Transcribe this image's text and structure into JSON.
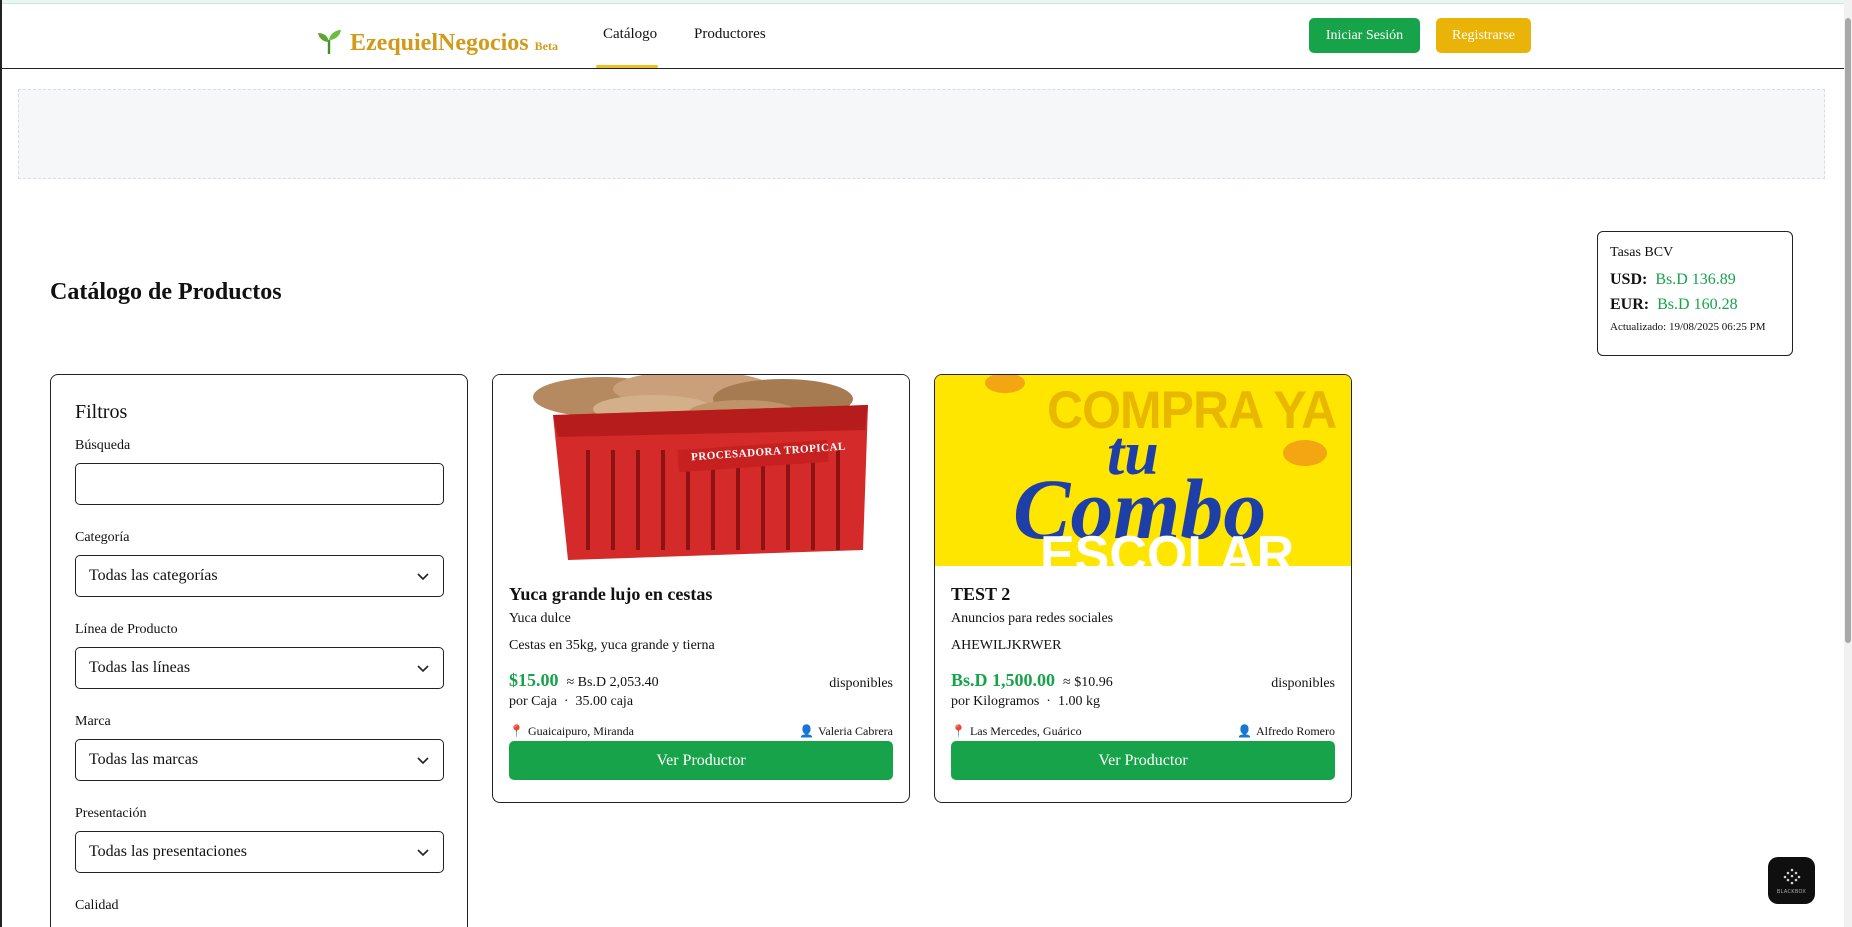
{
  "navbar": {
    "brand_name": "EzequielNegocios",
    "brand_badge": "Beta",
    "links": [
      "Catálogo",
      "Productores"
    ],
    "login_label": "Iniciar Sesión",
    "register_label": "Registrarse"
  },
  "page": {
    "title": "Catálogo de Productos"
  },
  "rates": {
    "title": "Tasas BCV",
    "usd_code": "USD:",
    "usd_value": "Bs.D 136.89",
    "eur_code": "EUR:",
    "eur_value": "Bs.D 160.28",
    "updated": "Actualizado: 19/08/2025 06:25 PM"
  },
  "filters": {
    "title": "Filtros",
    "search_label": "Búsqueda",
    "search_value": "",
    "category_label": "Categoría",
    "category_value": "Todas las categorías",
    "line_label": "Línea de Producto",
    "line_value": "Todas las líneas",
    "brand_label": "Marca",
    "brand_value": "Todas las marcas",
    "presentation_label": "Presentación",
    "presentation_value": "Todas las presentaciones",
    "quality_label": "Calidad"
  },
  "products": [
    {
      "name": "Yuca grande lujo en cestas",
      "category": "Yuca dulce",
      "description": "Cestas en 35kg, yuca grande y tierna",
      "price": "$15.00",
      "converted": "≈ Bs.D 2,053.40",
      "unit": "por Caja",
      "quantity": "35.00 caja",
      "availability": "disponibles",
      "location": "Guaicaipuro, Miranda",
      "seller": "Valeria Cabrera",
      "button_label": "Ver Productor",
      "image_text": "PROCESADORA TROPICAL"
    },
    {
      "name": "TEST 2",
      "category": "Anuncios para redes sociales",
      "description": "AHEWILJKRWER",
      "price": "Bs.D 1,500.00",
      "converted": "≈ $10.96",
      "unit": "por Kilogramos",
      "quantity": "1.00 kg",
      "availability": "disponibles",
      "location": "Las Mercedes, Guárico",
      "seller": "Alfredo Romero",
      "button_label": "Ver Productor",
      "image_text_1": "COMPRA YA",
      "image_text_2": "tu",
      "image_text_3": "Combo",
      "image_text_4": "ESCOLAR"
    }
  ],
  "widget": {
    "label": "BLACKBOX"
  },
  "colors": {
    "brand": "#d19a19",
    "primary_green": "#17a34a",
    "accent_yellow": "#eab308"
  }
}
